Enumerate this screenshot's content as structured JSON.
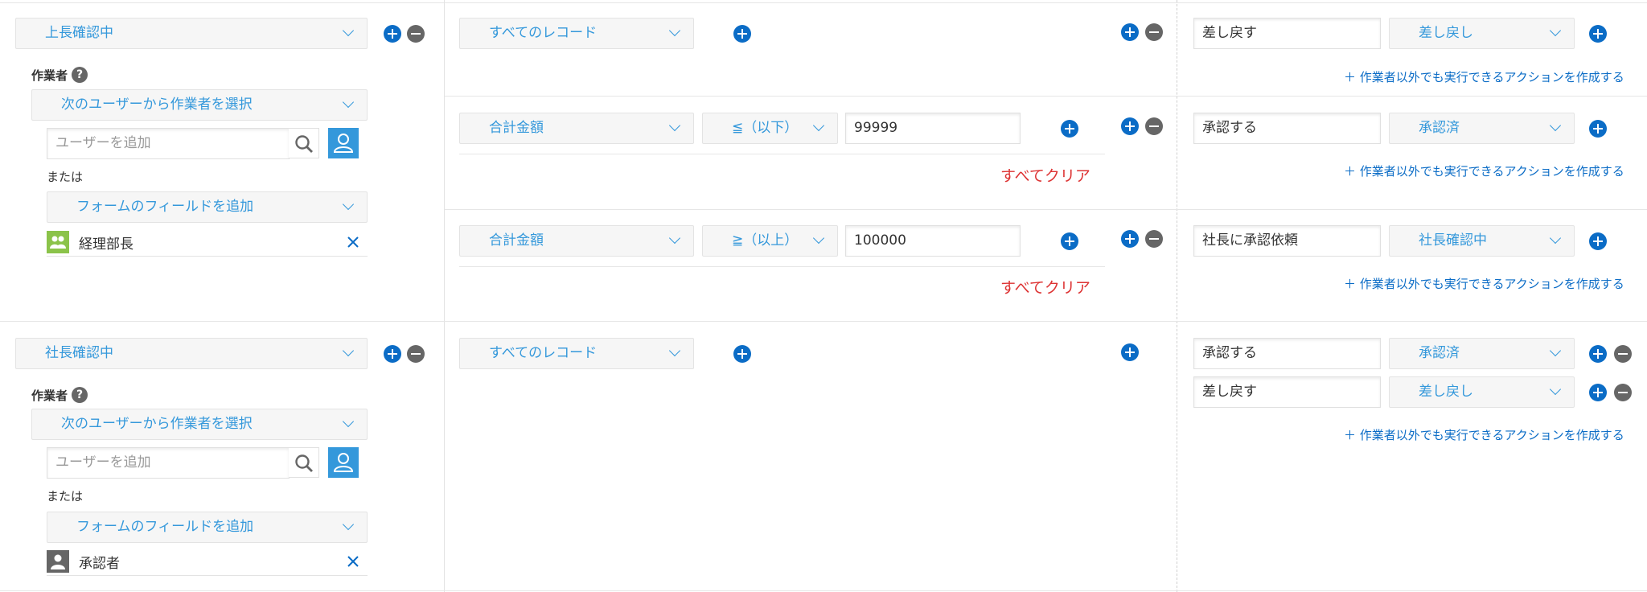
{
  "rows": [
    {
      "status": "上長確認中",
      "operator_label": "作業者",
      "help_mark": "?",
      "user_select": "次のユーザーから作業者を選択",
      "user_placeholder": "ユーザーを追加",
      "or_label": "または",
      "field_select": "フォームのフィールドを追加",
      "entry": "経理部長"
    },
    {
      "status": "社長確認中",
      "operator_label": "作業者",
      "help_mark": "?",
      "user_select": "次のユーザーから作業者を選択",
      "user_placeholder": "ユーザーを追加",
      "or_label": "または",
      "field_select": "フォームのフィールドを追加",
      "entry": "承認者"
    }
  ],
  "conditions": {
    "all_records_1": "すべてのレコード",
    "field_2": "合計金額",
    "op_2": "≦（以下）",
    "value_2": "99999",
    "field_3": "合計金額",
    "op_3": "≧（以上）",
    "value_3": "100000",
    "all_records_4": "すべてのレコード",
    "clear_label": "すべてクリア"
  },
  "actions": {
    "a1_name": "差し戻す",
    "a1_status": "差し戻し",
    "a2_name": "承認する",
    "a2_status": "承認済",
    "a3_name": "社長に承認依頼",
    "a3_status": "社長確認中",
    "a4_name": "承認する",
    "a4_status": "承認済",
    "a5_name": "差し戻す",
    "a5_status": "差し戻し",
    "create_action_link": "＋ 作業者以外でも実行できるアクションを作成する"
  },
  "colors": {
    "accent": "#3498db",
    "plus_button": "#0b6cc6",
    "clear_text": "#d33333"
  }
}
